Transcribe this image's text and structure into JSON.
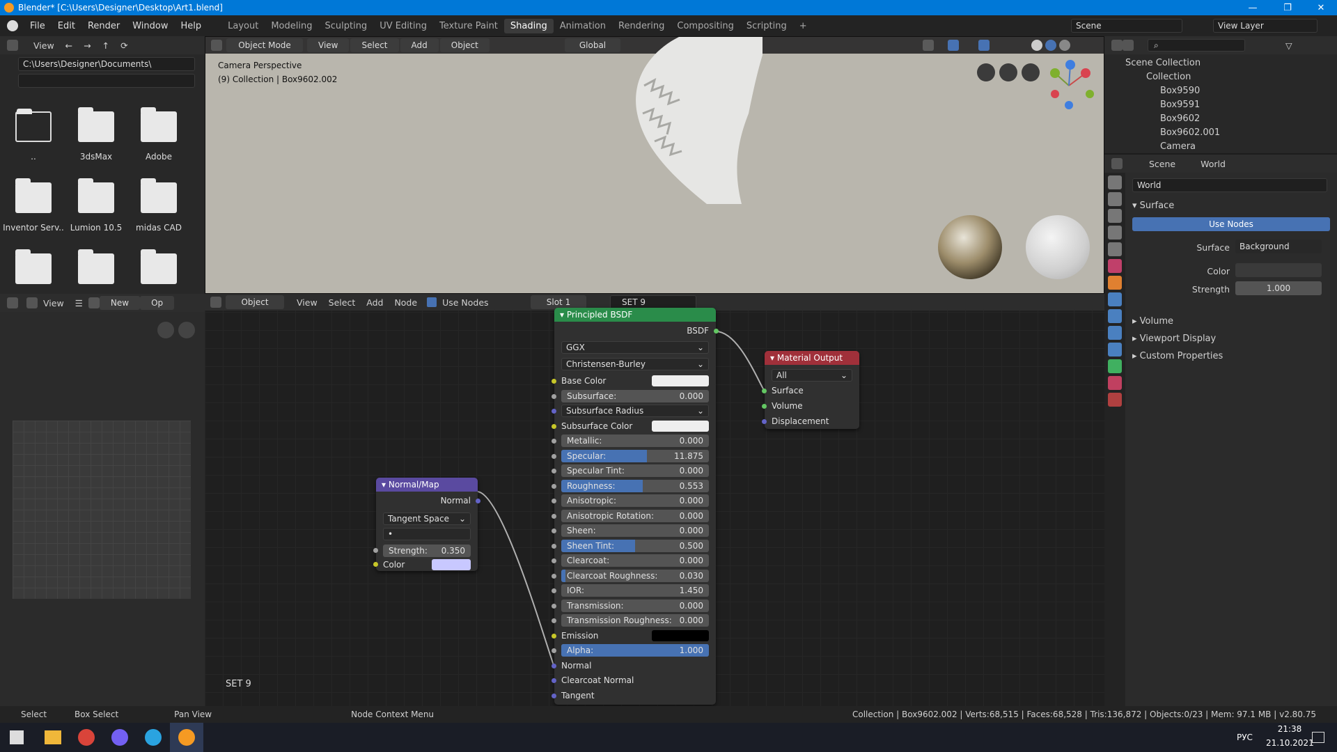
{
  "window": {
    "title": "Blender* [C:\\Users\\Designer\\Desktop\\Art1.blend]",
    "minimize": "—",
    "maximize": "❐",
    "close": "✕"
  },
  "menus": [
    "File",
    "Edit",
    "Render",
    "Window",
    "Help"
  ],
  "workspaces": [
    "Layout",
    "Modeling",
    "Sculpting",
    "UV Editing",
    "Texture Paint",
    "Shading",
    "Animation",
    "Rendering",
    "Compositing",
    "Scripting",
    "+"
  ],
  "active_workspace": "Shading",
  "scene_selector": "Scene",
  "view_layer": "View Layer",
  "filebrowser": {
    "view_label": "View",
    "path": "C:\\Users\\Designer\\Documents\\",
    "items": [
      "..",
      "3dsMax",
      "Adobe",
      "Inventor Serv..",
      "Lumion 10.5",
      "midas CAD",
      "",
      "",
      ""
    ]
  },
  "viewport": {
    "mode": "Object Mode",
    "menus": [
      "View",
      "Select",
      "Add",
      "Object"
    ],
    "transform": "Global",
    "info1": "Camera Perspective",
    "info2": "(9) Collection | Box9602.002"
  },
  "image_editor": {
    "view": "View",
    "new": "New",
    "open": "Op"
  },
  "node_editor": {
    "object": "Object",
    "menus": [
      "View",
      "Select",
      "Add",
      "Node"
    ],
    "use_nodes": "Use Nodes",
    "slot": "Slot 1",
    "material": "SET 9",
    "footer_name": "SET 9"
  },
  "principled": {
    "title": "Principled BSDF",
    "out": "BSDF",
    "distribution": "GGX",
    "subsurface_method": "Christensen-Burley",
    "rows": [
      {
        "label": "Base Color",
        "kind": "color",
        "color": "#eeeeee"
      },
      {
        "label": "Subsurface:",
        "value": "0.000",
        "fill": 0
      },
      {
        "label": "Subsurface Radius",
        "kind": "drop"
      },
      {
        "label": "Subsurface Color",
        "kind": "color",
        "color": "#eeeeee"
      },
      {
        "label": "Metallic:",
        "value": "0.000",
        "fill": 0
      },
      {
        "label": "Specular:",
        "value": "11.875",
        "fill": 0.58
      },
      {
        "label": "Specular Tint:",
        "value": "0.000",
        "fill": 0
      },
      {
        "label": "Roughness:",
        "value": "0.553",
        "fill": 0.553
      },
      {
        "label": "Anisotropic:",
        "value": "0.000",
        "fill": 0
      },
      {
        "label": "Anisotropic Rotation:",
        "value": "0.000",
        "fill": 0
      },
      {
        "label": "Sheen:",
        "value": "0.000",
        "fill": 0
      },
      {
        "label": "Sheen Tint:",
        "value": "0.500",
        "fill": 0.5
      },
      {
        "label": "Clearcoat:",
        "value": "0.000",
        "fill": 0
      },
      {
        "label": "Clearcoat Roughness:",
        "value": "0.030",
        "fill": 0.03
      },
      {
        "label": "IOR:",
        "value": "1.450",
        "fill": 0
      },
      {
        "label": "Transmission:",
        "value": "0.000",
        "fill": 0
      },
      {
        "label": "Transmission Roughness:",
        "value": "0.000",
        "fill": 0
      },
      {
        "label": "Emission",
        "kind": "color",
        "color": "#000000"
      },
      {
        "label": "Alpha:",
        "value": "1.000",
        "fill": 1
      },
      {
        "label": "Normal",
        "kind": "label"
      },
      {
        "label": "Clearcoat Normal",
        "kind": "label"
      },
      {
        "label": "Tangent",
        "kind": "label"
      }
    ]
  },
  "normalmap": {
    "title": "Normal/Map",
    "out": "Normal",
    "space": "Tangent Space",
    "uv": "•",
    "strength_label": "Strength:",
    "strength": "0.350",
    "color_label": "Color",
    "color": "#c8c8ff"
  },
  "matout": {
    "title": "Material Output",
    "target": "All",
    "inputs": [
      "Surface",
      "Volume",
      "Displacement"
    ]
  },
  "outliner": {
    "root": "Scene Collection",
    "items": [
      "Collection",
      "Box9590",
      "Box9591",
      "Box9602",
      "Box9602.001",
      "Camera"
    ]
  },
  "properties": {
    "tab1": "Scene",
    "tab2": "World",
    "world_name": "World",
    "panel": "Surface",
    "use_nodes": "Use Nodes",
    "surface_label": "Surface",
    "surface_value": "Background",
    "color_label": "Color",
    "strength_label": "Strength",
    "strength": "1.000",
    "collapsed": [
      "Volume",
      "Viewport Display",
      "Custom Properties"
    ]
  },
  "statusbar": {
    "left": [
      "Select",
      "Box Select",
      "Pan View",
      "Node Context Menu"
    ],
    "right": "Collection | Box9602.002 | Verts:68,515 | Faces:68,528 | Tris:136,872 | Objects:0/23 | Mem: 97.1 MB | v2.80.75"
  },
  "taskbar": {
    "lang": "РУС",
    "time": "21:38",
    "date": "21.10.2021"
  }
}
